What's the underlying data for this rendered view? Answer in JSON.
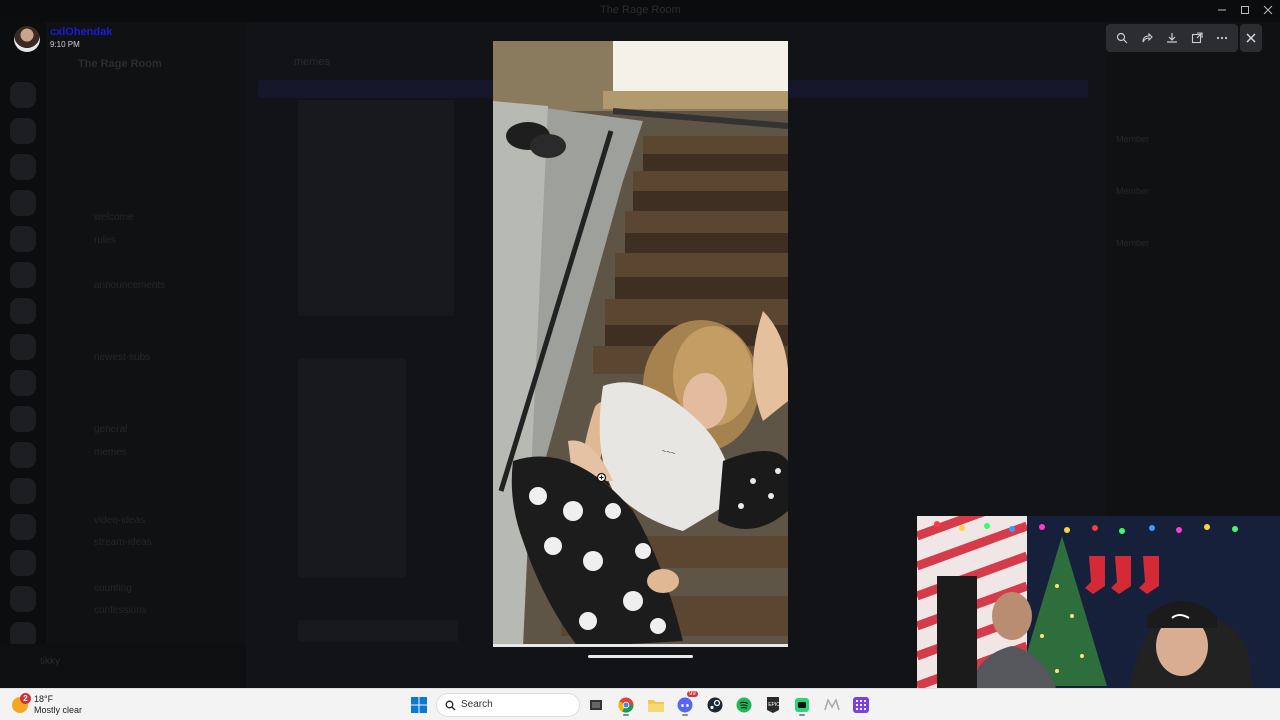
{
  "window": {
    "title": "The Rage Room"
  },
  "user_overlay": {
    "username": "cxlOhendak",
    "time": "9:10 PM"
  },
  "discord_bg": {
    "server_name": "The Rage Room",
    "channel_header": "memes",
    "channels": [
      {
        "label": "welcome",
        "kind": "channel"
      },
      {
        "label": "rules",
        "kind": "channel"
      },
      {
        "label": "announcements",
        "kind": "channel"
      },
      {
        "label": "newest-subs",
        "kind": "channel"
      },
      {
        "label": "general",
        "kind": "channel"
      },
      {
        "label": "memes",
        "kind": "channel"
      },
      {
        "label": "video-ideas",
        "kind": "channel"
      },
      {
        "label": "stream-ideas",
        "kind": "channel"
      },
      {
        "label": "counting",
        "kind": "channel"
      },
      {
        "label": "confessions",
        "kind": "channel"
      }
    ],
    "members": [
      "Member",
      "Member",
      "Member"
    ],
    "self_name": "tikky"
  },
  "viewer_toolbar": {
    "icons": [
      "zoom-icon",
      "forward-icon",
      "download-icon",
      "open-external-icon",
      "more-icon"
    ],
    "close_icon": "close-icon"
  },
  "photo": {
    "description_icon": "zoom-cursor-icon"
  },
  "taskbar": {
    "weather": {
      "badge": "2",
      "temp": "18°F",
      "condition": "Mostly clear"
    },
    "search_placeholder": "Search",
    "discord_badge": "99",
    "apps": [
      "windows-start-icon",
      "search-icon",
      "file-explorer-icon",
      "chrome-icon",
      "folder-icon",
      "discord-icon",
      "steam-icon",
      "spotify-icon",
      "epic-games-icon",
      "app-icon",
      "m-app-icon",
      "grid-app-icon"
    ]
  },
  "colors": {
    "discord_bg": "#111214",
    "taskbar": "#f3f3f3",
    "accent_blue": "#1a1ae0"
  }
}
